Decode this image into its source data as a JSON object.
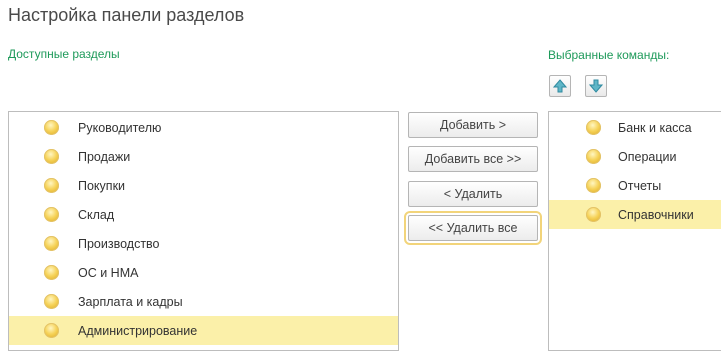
{
  "window": {
    "title": "Настройка панели разделов"
  },
  "available": {
    "label": "Доступные разделы",
    "items": [
      {
        "label": "Руководителю",
        "icon": "bulb-icon",
        "selected": false
      },
      {
        "label": "Продажи",
        "icon": "bulb-icon",
        "selected": false
      },
      {
        "label": "Покупки",
        "icon": "bulb-icon",
        "selected": false
      },
      {
        "label": "Склад",
        "icon": "bulb-icon",
        "selected": false
      },
      {
        "label": "Производство",
        "icon": "bulb-icon",
        "selected": false
      },
      {
        "label": "ОС и НМА",
        "icon": "bulb-icon",
        "selected": false
      },
      {
        "label": "Зарплата и кадры",
        "icon": "bulb-icon",
        "selected": false
      },
      {
        "label": "Администрирование",
        "icon": "bulb-icon",
        "selected": true
      }
    ]
  },
  "selected": {
    "label": "Выбранные команды:",
    "move_up_icon": "arrow-up-icon",
    "move_down_icon": "arrow-down-icon",
    "items": [
      {
        "label": "Банк и касса",
        "icon": "bulb-icon",
        "selected": false
      },
      {
        "label": "Операции",
        "icon": "bulb-icon",
        "selected": false
      },
      {
        "label": "Отчеты",
        "icon": "bulb-icon",
        "selected": false
      },
      {
        "label": "Справочники",
        "icon": "bulb-icon",
        "selected": true
      }
    ]
  },
  "actions": {
    "add": "Добавить >",
    "add_all": "Добавить все >>",
    "remove": "< Удалить",
    "remove_all": "<< Удалить все"
  },
  "colors": {
    "accent_green": "#1e9a5a",
    "selection": "#fbf0a9",
    "focus_outline": "#f2d47a"
  }
}
